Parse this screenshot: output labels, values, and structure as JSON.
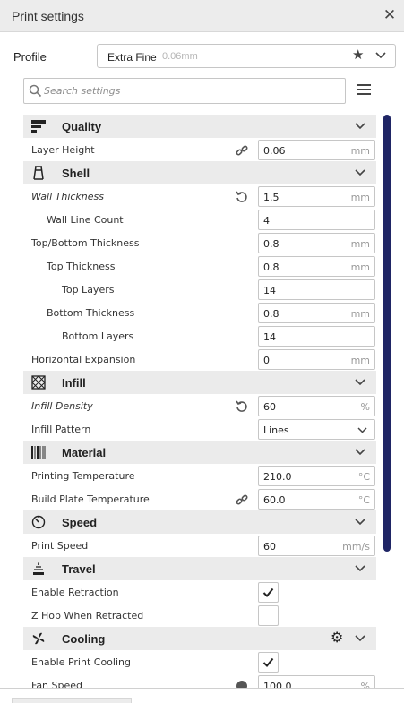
{
  "window": {
    "title": "Print settings",
    "close_icon": "close-icon"
  },
  "profile": {
    "label": "Profile",
    "name": "Extra Fine",
    "detail": "0.06mm"
  },
  "search": {
    "placeholder": "Search settings",
    "value": ""
  },
  "categories": {
    "quality": {
      "title": "Quality"
    },
    "shell": {
      "title": "Shell"
    },
    "infill": {
      "title": "Infill"
    },
    "material": {
      "title": "Material"
    },
    "speed": {
      "title": "Speed"
    },
    "travel": {
      "title": "Travel"
    },
    "cooling": {
      "title": "Cooling"
    }
  },
  "settings": {
    "layer_height": {
      "label": "Layer Height",
      "value": "0.06",
      "unit": "mm"
    },
    "wall_thickness": {
      "label": "Wall Thickness",
      "value": "1.5",
      "unit": "mm"
    },
    "wall_line_count": {
      "label": "Wall Line Count",
      "value": "4"
    },
    "top_bottom_thickness": {
      "label": "Top/Bottom Thickness",
      "value": "0.8",
      "unit": "mm"
    },
    "top_thickness": {
      "label": "Top Thickness",
      "value": "0.8",
      "unit": "mm"
    },
    "top_layers": {
      "label": "Top Layers",
      "value": "14"
    },
    "bottom_thickness": {
      "label": "Bottom Thickness",
      "value": "0.8",
      "unit": "mm"
    },
    "bottom_layers": {
      "label": "Bottom Layers",
      "value": "14"
    },
    "horizontal_expansion": {
      "label": "Horizontal Expansion",
      "value": "0",
      "unit": "mm"
    },
    "infill_density": {
      "label": "Infill Density",
      "value": "60",
      "unit": "%"
    },
    "infill_pattern": {
      "label": "Infill Pattern",
      "value": "Lines"
    },
    "printing_temperature": {
      "label": "Printing Temperature",
      "value": "210.0",
      "unit": "°C"
    },
    "build_plate_temperature": {
      "label": "Build Plate Temperature",
      "value": "60.0",
      "unit": "°C"
    },
    "print_speed": {
      "label": "Print Speed",
      "value": "60",
      "unit": "mm/s"
    },
    "enable_retraction": {
      "label": "Enable Retraction",
      "checked": true
    },
    "z_hop_when_retracted": {
      "label": "Z Hop When Retracted",
      "checked": false
    },
    "enable_print_cooling": {
      "label": "Enable Print Cooling",
      "checked": true
    },
    "fan_speed": {
      "label": "Fan Speed",
      "value": "100.0",
      "unit": "%"
    }
  },
  "colors": {
    "accent": "#1f2565",
    "category_bg": "#ebebeb",
    "border": "#c6c6c6"
  }
}
